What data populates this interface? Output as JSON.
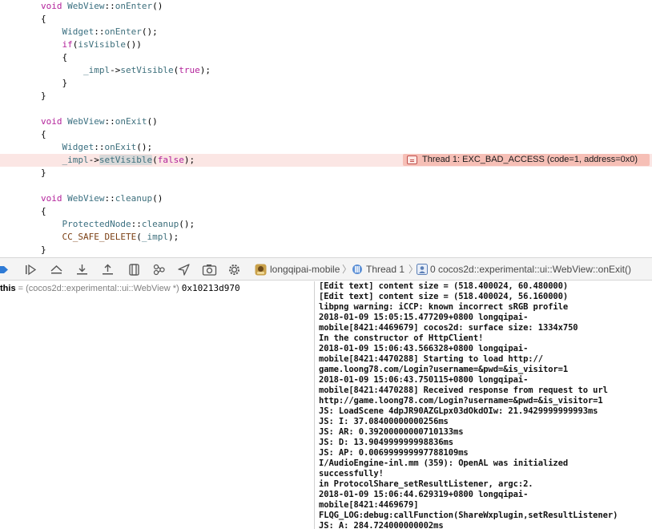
{
  "editor": {
    "lines": [
      [
        [
          "void ",
          "kw"
        ],
        [
          "WebView",
          "ty"
        ],
        [
          "::",
          "pl"
        ],
        [
          "onEnter",
          "fn"
        ],
        [
          "()",
          "pl"
        ]
      ],
      [
        [
          "{",
          "pl"
        ]
      ],
      [
        [
          "    ",
          "pl"
        ],
        [
          "Widget",
          "ty"
        ],
        [
          "::",
          "pl"
        ],
        [
          "onEnter",
          "fn"
        ],
        [
          "();",
          "pl"
        ]
      ],
      [
        [
          "    ",
          "pl"
        ],
        [
          "if",
          "kw"
        ],
        [
          "(",
          "pl"
        ],
        [
          "isVisible",
          "fn"
        ],
        [
          "())",
          "pl"
        ]
      ],
      [
        [
          "    {",
          "pl"
        ]
      ],
      [
        [
          "        ",
          "pl"
        ],
        [
          "_impl",
          "sym"
        ],
        [
          "->",
          "pl"
        ],
        [
          "setVisible",
          "fn"
        ],
        [
          "(",
          "pl"
        ],
        [
          "true",
          "kw"
        ],
        [
          ");",
          "pl"
        ]
      ],
      [
        [
          "    }",
          "pl"
        ]
      ],
      [
        [
          "}",
          "pl"
        ]
      ],
      [
        [
          "",
          "pl"
        ]
      ],
      [
        [
          "void ",
          "kw"
        ],
        [
          "WebView",
          "ty"
        ],
        [
          "::",
          "pl"
        ],
        [
          "onExit",
          "fn"
        ],
        [
          "()",
          "pl"
        ]
      ],
      [
        [
          "{",
          "pl"
        ]
      ],
      [
        [
          "    ",
          "pl"
        ],
        [
          "Widget",
          "ty"
        ],
        [
          "::",
          "pl"
        ],
        [
          "onExit",
          "fn"
        ],
        [
          "();",
          "pl"
        ]
      ],
      [
        [
          "    ",
          "pl"
        ],
        [
          "_impl",
          "sym"
        ],
        [
          "->",
          "pl"
        ],
        [
          "setVisible",
          "fn hl"
        ],
        [
          "(",
          "pl"
        ],
        [
          "false",
          "kw"
        ],
        [
          ");",
          "pl"
        ]
      ],
      [
        [
          "}",
          "pl"
        ]
      ],
      [
        [
          "",
          "pl"
        ]
      ],
      [
        [
          "void ",
          "kw"
        ],
        [
          "WebView",
          "ty"
        ],
        [
          "::",
          "pl"
        ],
        [
          "cleanup",
          "fn"
        ],
        [
          "()",
          "pl"
        ]
      ],
      [
        [
          "{",
          "pl"
        ]
      ],
      [
        [
          "    ",
          "pl"
        ],
        [
          "ProtectedNode",
          "ty"
        ],
        [
          "::",
          "pl"
        ],
        [
          "cleanup",
          "fn"
        ],
        [
          "();",
          "pl"
        ]
      ],
      [
        [
          "    ",
          "pl"
        ],
        [
          "CC_SAFE_DELETE",
          "mac"
        ],
        [
          "(",
          "pl"
        ],
        [
          "_impl",
          "sym"
        ],
        [
          ");",
          "pl"
        ]
      ],
      [
        [
          "}",
          "pl"
        ]
      ]
    ],
    "error_line_index": 12,
    "error_message": "Thread 1: EXC_BAD_ACCESS (code=1, address=0x0)"
  },
  "debug_bar": {
    "buttons": [
      "breakpoints-toggle-icon",
      "continue-icon",
      "step-over-icon",
      "step-into-icon",
      "step-out-icon",
      "view-hierarchy-icon",
      "memory-graph-icon",
      "location-icon",
      "camera-icon",
      "gear-icon"
    ],
    "breadcrumb": {
      "app": "longqipai-mobile",
      "thread": "Thread 1",
      "frame": "0 cocos2d::experimental::ui::WebView::onExit()"
    }
  },
  "variables": {
    "rows": [
      {
        "name": "this",
        "type": "= (cocos2d::experimental::ui::WebView *)",
        "value": "0x10213d970"
      }
    ]
  },
  "console": {
    "lines": [
      "[Edit text] content size = (518.400024, 60.480000)",
      "[Edit text] content size = (518.400024, 56.160000)",
      "libpng warning: iCCP: known incorrect sRGB profile",
      "2018-01-09 15:05:15.477209+0800 longqipai-",
      "mobile[8421:4469679] cocos2d: surface size: 1334x750",
      "In the constructor of HttpClient!",
      "2018-01-09 15:06:43.566328+0800 longqipai-",
      "mobile[8421:4470288] Starting to load http://",
      "game.loong78.com/Login?username=&pwd=&is_visitor=1",
      "2018-01-09 15:06:43.750115+0800 longqipai-",
      "mobile[8421:4470288] Received response from request to url",
      "http://game.loong78.com/Login?username=&pwd=&is_visitor=1",
      "JS: LoadScene 4dpJR90AZGLpx03dOkdOIw: 21.9429999999993ms",
      "JS: I: 37.08400000000256ms",
      "JS: AR: 0.39200000000710133ms",
      "JS: D: 13.904999999998836ms",
      "JS: AP: 0.006999999997788109ms",
      "I/AudioEngine-inl.mm (359): OpenAL was initialized",
      "successfully!",
      "in ProtocolShare_setResultListener, argc:2.",
      "2018-01-09 15:06:44.629319+0800 longqipai-",
      "mobile[8421:4469679]",
      "FLQG_LOG:debug:callFunction(ShareWxplugin,setResultListener)",
      "JS: A: 284.724000000002ms"
    ]
  }
}
